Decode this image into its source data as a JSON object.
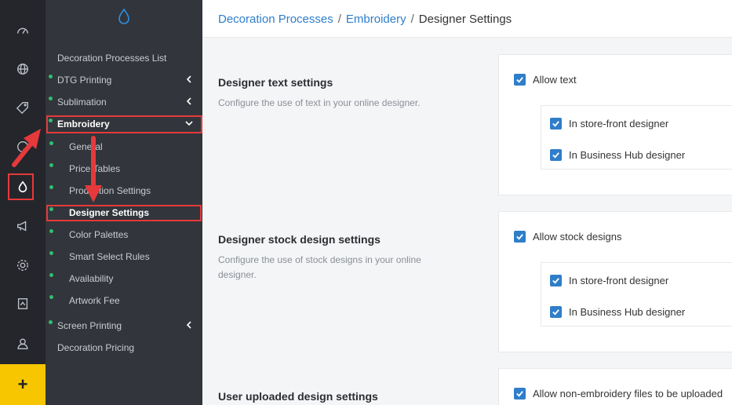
{
  "rail": {
    "icons": [
      "dashboard-icon",
      "globe-icon",
      "tag-icon",
      "palette-icon",
      "drop-icon",
      "megaphone-icon",
      "gear-icon",
      "ribbon-icon",
      "user-icon"
    ],
    "add_label": "+"
  },
  "subnav": {
    "logo_icon": "drop-icon",
    "items": [
      {
        "label": "Decoration Processes List"
      },
      {
        "label": "DTG Printing"
      },
      {
        "label": "Sublimation"
      },
      {
        "label": "Embroidery"
      },
      {
        "label": "General"
      },
      {
        "label": "Price Tables"
      },
      {
        "label": "Production Settings"
      },
      {
        "label": "Designer Settings"
      },
      {
        "label": "Color Palettes"
      },
      {
        "label": "Smart Select Rules"
      },
      {
        "label": "Availability"
      },
      {
        "label": "Artwork Fee"
      },
      {
        "label": "Screen Printing"
      },
      {
        "label": "Decoration Pricing"
      }
    ]
  },
  "breadcrumb": {
    "part1": "Decoration Processes",
    "part2": "Embroidery",
    "current": "Designer Settings",
    "separator": "/"
  },
  "sections": [
    {
      "title": "Designer text settings",
      "description": "Configure the use of text in your online designer.",
      "main_option": "Allow text",
      "sub_options": [
        "In store-front designer",
        "In Business Hub designer"
      ]
    },
    {
      "title": "Designer stock design settings",
      "description": "Configure the use of stock designs in your online designer.",
      "main_option": "Allow stock designs",
      "sub_options": [
        "In store-front designer",
        "In Business Hub designer"
      ]
    },
    {
      "title": "User uploaded design settings",
      "main_option": "Allow non-embroidery files to be uploaded"
    }
  ],
  "colors": {
    "accent": "#2f7ec9",
    "highlight": "#e5393b",
    "active_dot": "#2fbf6f",
    "add_button": "#f7c600"
  }
}
